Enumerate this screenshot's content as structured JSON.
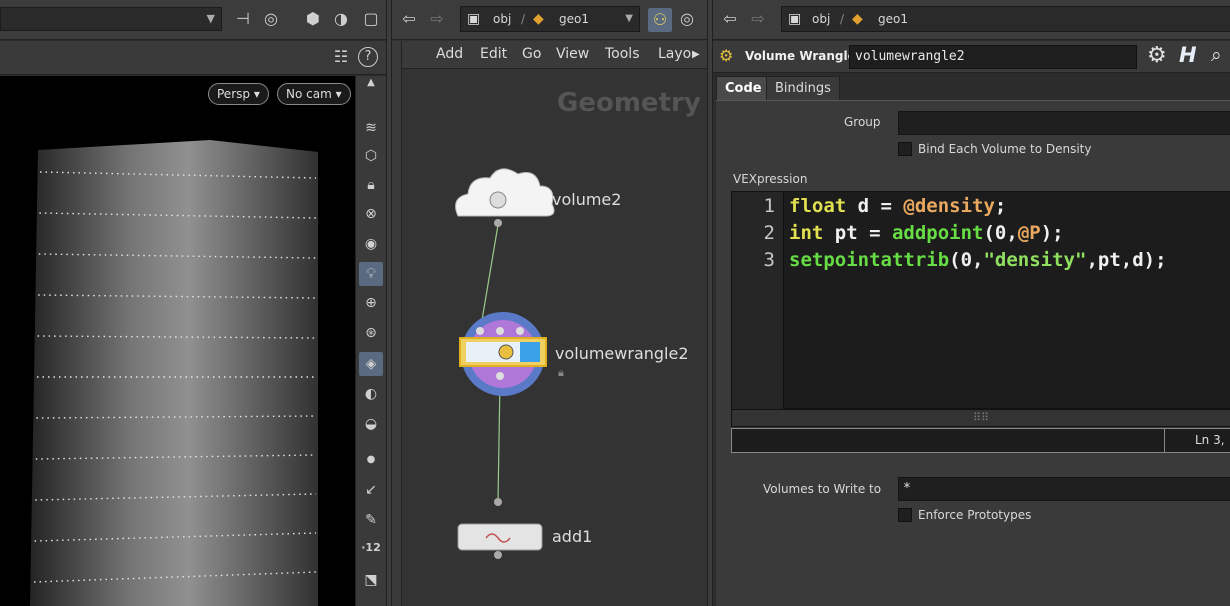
{
  "viewport": {
    "camera_view": "Persp",
    "camera_select": "No cam"
  },
  "network": {
    "crumbs": [
      "obj",
      "geo1"
    ],
    "menu": [
      "Add",
      "Edit",
      "Go",
      "View",
      "Tools",
      "Layo"
    ],
    "context_title": "Geometry",
    "nodes": [
      {
        "label": "volume2"
      },
      {
        "label": "volumewrangle2"
      },
      {
        "label": "add1"
      }
    ]
  },
  "params": {
    "crumbs": [
      "obj",
      "geo1"
    ],
    "node_type": "Volume Wrangle",
    "node_name": "volumewrangle2",
    "tabs": [
      "Code",
      "Bindings"
    ],
    "group_label": "Group",
    "group_value": "",
    "bind_label": "Bind Each Volume to Density",
    "vex_label": "VEXpression",
    "code_lines": [
      {
        "num": "1",
        "tokens": [
          {
            "t": "float",
            "c": "k"
          },
          {
            "t": " d = ",
            "c": "w"
          },
          {
            "t": "@density",
            "c": "a"
          },
          {
            "t": ";",
            "c": "w"
          }
        ]
      },
      {
        "num": "2",
        "tokens": [
          {
            "t": "int",
            "c": "k"
          },
          {
            "t": " pt = ",
            "c": "w"
          },
          {
            "t": "addpoint",
            "c": "f"
          },
          {
            "t": "(0,",
            "c": "w"
          },
          {
            "t": "@P",
            "c": "a"
          },
          {
            "t": ");",
            "c": "w"
          }
        ]
      },
      {
        "num": "3",
        "tokens": [
          {
            "t": "setpointattrib",
            "c": "f"
          },
          {
            "t": "(0,",
            "c": "w"
          },
          {
            "t": "\"density\"",
            "c": "s"
          },
          {
            "t": ",pt,d);",
            "c": "w"
          }
        ]
      }
    ],
    "status_position": "Ln 3,",
    "write_label": "Volumes to Write to",
    "write_value": "*",
    "enforce_label": "Enforce Prototypes"
  },
  "colors": {
    "keyword": "#e0e050",
    "function": "#66dd44",
    "attribute": "#e8a860",
    "string": "#90e060",
    "accent": "#5a6a80"
  }
}
